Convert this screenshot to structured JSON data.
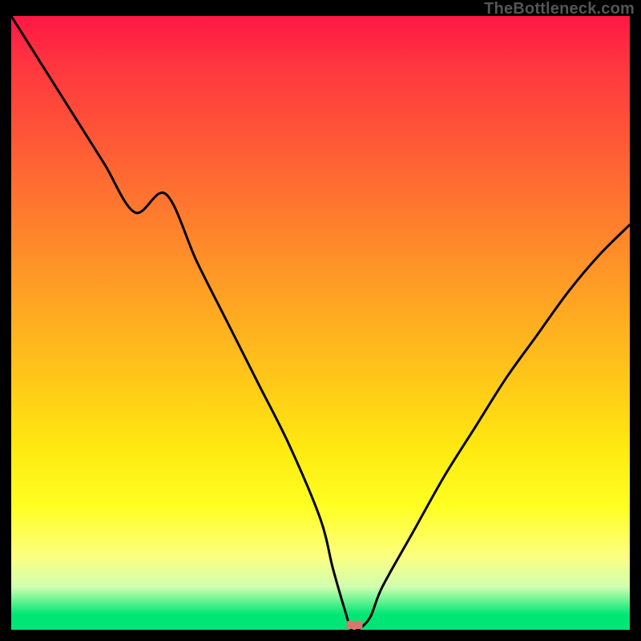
{
  "watermark": "TheBottleneck.com",
  "colors": {
    "background": "#000000",
    "curve_stroke": "#000000",
    "sweet_spot_fill": "#d9776f",
    "gradient_top": "#ff1744",
    "gradient_bottom": "#00e676"
  },
  "chart_data": {
    "type": "line",
    "title": "",
    "xlabel": "",
    "ylabel": "",
    "xlim": [
      0,
      100
    ],
    "ylim": [
      0,
      100
    ],
    "grid": false,
    "series": [
      {
        "name": "bottleneck-curve",
        "x": [
          0,
          5,
          10,
          15,
          20,
          25,
          30,
          35,
          40,
          45,
          50,
          52,
          54,
          55,
          56,
          58,
          60,
          65,
          70,
          75,
          80,
          85,
          90,
          95,
          100
        ],
        "values": [
          100,
          92,
          84,
          76,
          68,
          71,
          60,
          50,
          40,
          30,
          18,
          10,
          3,
          0,
          0,
          2,
          7,
          16,
          25,
          33,
          41,
          48,
          55,
          61,
          66
        ]
      }
    ],
    "sweet_spot": {
      "x_center": 55.5,
      "width": 2.6,
      "height": 0.8
    },
    "notes": "Values are estimated from the image on a 0-100 scale for both axes (top of plot = 100, bottom = 0). The curve descends from upper-left, flattens near x≈55 at y≈0, then rises toward the right edge reaching roughly y≈66 at x=100. No axis tick labels are shown in the source image."
  }
}
